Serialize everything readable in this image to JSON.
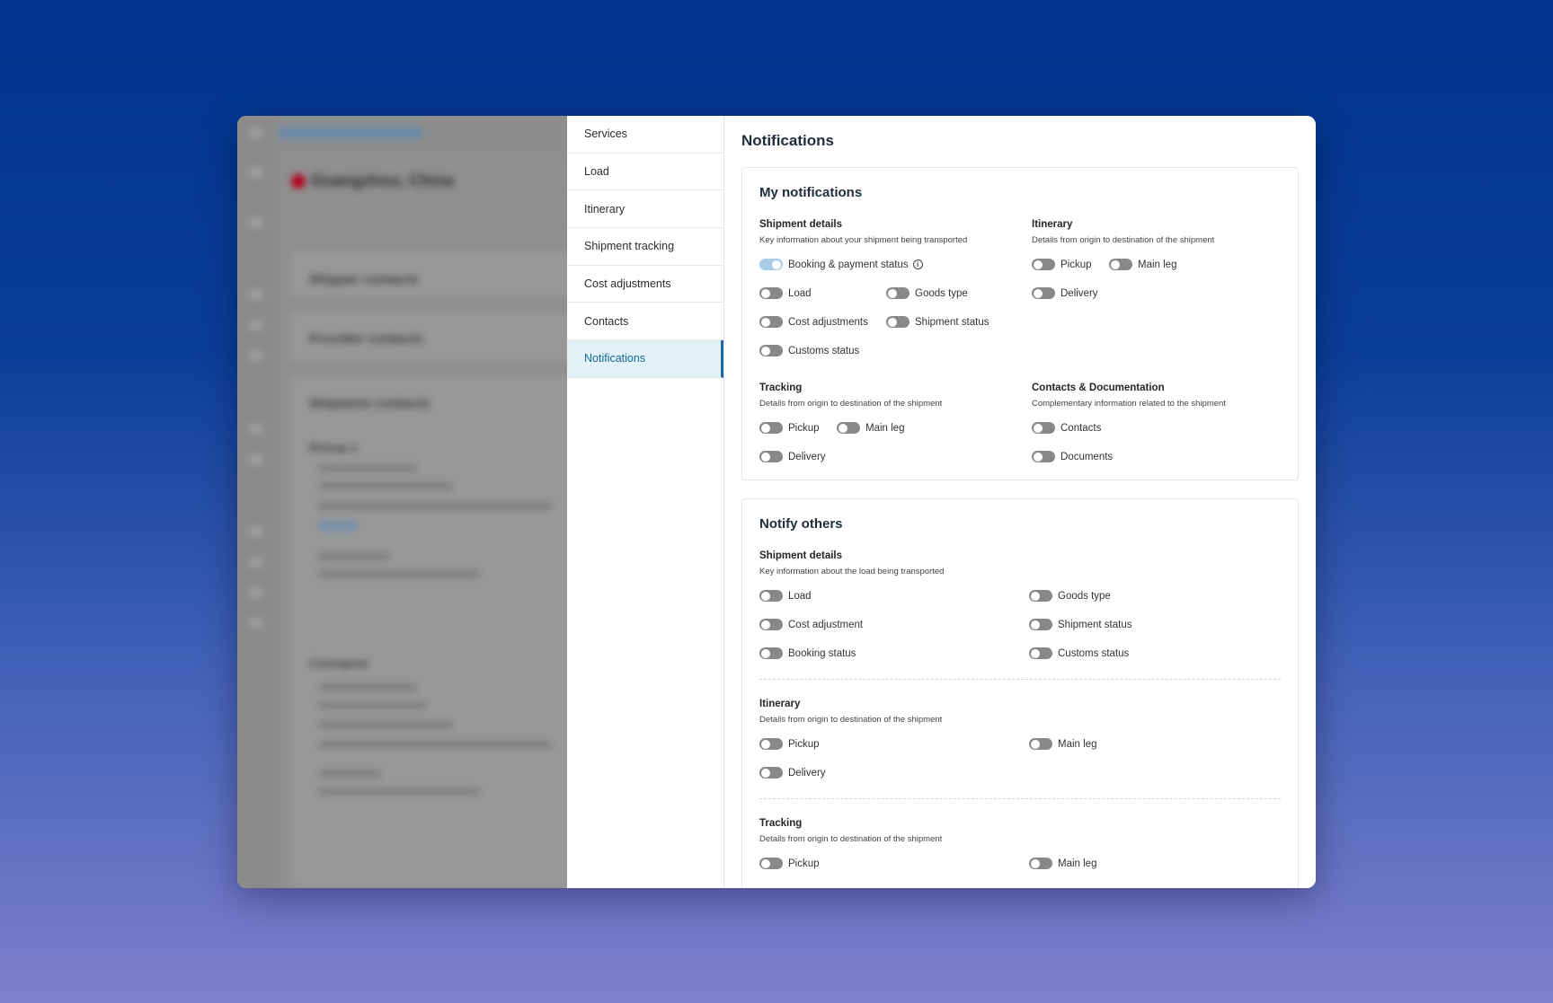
{
  "sidenav": {
    "items": [
      {
        "label": "Services"
      },
      {
        "label": "Load"
      },
      {
        "label": "Itinerary"
      },
      {
        "label": "Shipment tracking"
      },
      {
        "label": "Cost adjustments"
      },
      {
        "label": "Contacts"
      },
      {
        "label": "Notifications"
      }
    ],
    "active": "Notifications"
  },
  "page": {
    "title": "Notifications"
  },
  "my_notifications": {
    "title": "My notifications",
    "shipment_details": {
      "title": "Shipment details",
      "subtitle": "Key information about your shipment being transported",
      "toggles": {
        "booking": {
          "label": "Booking & payment status",
          "on": true
        },
        "load": {
          "label": "Load",
          "on": false
        },
        "goods_type": {
          "label": "Goods type",
          "on": false
        },
        "cost_adjustments": {
          "label": "Cost adjustments",
          "on": false
        },
        "shipment_status": {
          "label": "Shipment status",
          "on": false
        },
        "customs_status": {
          "label": "Customs status",
          "on": false
        }
      }
    },
    "itinerary": {
      "title": "Itinerary",
      "subtitle": "Details from origin to destination of the shipment",
      "toggles": {
        "pickup": {
          "label": "Pickup",
          "on": false
        },
        "main_leg": {
          "label": "Main leg",
          "on": false
        },
        "delivery": {
          "label": "Delivery",
          "on": false
        }
      }
    },
    "tracking": {
      "title": "Tracking",
      "subtitle": "Details from origin to destination of the shipment",
      "toggles": {
        "pickup": {
          "label": "Pickup",
          "on": false
        },
        "main_leg": {
          "label": "Main leg",
          "on": false
        },
        "delivery": {
          "label": "Delivery",
          "on": false
        }
      }
    },
    "contacts_docs": {
      "title": "Contacts & Documentation",
      "subtitle": "Complementary information related to the shipment",
      "toggles": {
        "contacts": {
          "label": "Contacts",
          "on": false
        },
        "documents": {
          "label": "Documents",
          "on": false
        }
      }
    }
  },
  "notify_others": {
    "title": "Notify others",
    "shipment_details": {
      "title": "Shipment details",
      "subtitle": "Key information about the load being transported",
      "toggles": {
        "load": {
          "label": "Load",
          "on": false
        },
        "goods_type": {
          "label": "Goods type",
          "on": false
        },
        "cost_adjustment": {
          "label": "Cost adjustment",
          "on": false
        },
        "shipment_status": {
          "label": "Shipment status",
          "on": false
        },
        "booking_status": {
          "label": "Booking status",
          "on": false
        },
        "customs_status": {
          "label": "Customs status",
          "on": false
        }
      }
    },
    "itinerary": {
      "title": "Itinerary",
      "subtitle": "Details from origin to destination of the shipment",
      "toggles": {
        "pickup": {
          "label": "Pickup",
          "on": false
        },
        "main_leg": {
          "label": "Main leg",
          "on": false
        },
        "delivery": {
          "label": "Delivery",
          "on": false
        }
      }
    },
    "tracking": {
      "title": "Tracking",
      "subtitle": "Details from origin to destination of the shipment",
      "toggles": {
        "pickup": {
          "label": "Pickup",
          "on": false
        },
        "main_leg": {
          "label": "Main leg",
          "on": false
        }
      }
    }
  },
  "background_app": {
    "route": "Guangzhou, China",
    "cards": [
      "Shipper contacts",
      "Provider contacts",
      "Shipment contacts",
      "Pickup 1",
      "Consignee"
    ]
  },
  "colors": {
    "accent": "#1a6aa8",
    "active_nav_bg": "#e3f2f7",
    "toggle_off": "#888888",
    "toggle_on": "#a8cbe6"
  }
}
